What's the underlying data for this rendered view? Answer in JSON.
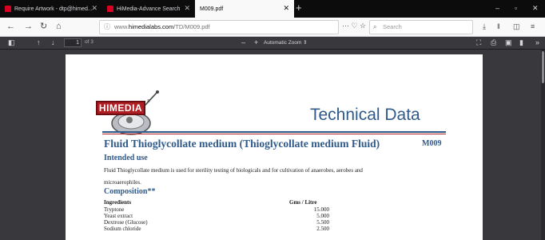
{
  "browser": {
    "tabs": [
      {
        "label": "Require Artwork - dtp@himed..."
      },
      {
        "label": "HiMedia-Advance Search"
      },
      {
        "label": "M009.pdf"
      }
    ],
    "url_prefix": "www.",
    "url_domain": "himedialabs.com",
    "url_path": "/TD/M009.pdf",
    "search_placeholder": "Search"
  },
  "pdf_toolbar": {
    "page_number": "1",
    "page_of": "of 3",
    "zoom": "Automatic Zoom"
  },
  "document": {
    "brand": "HIMEDIA",
    "header": "Technical Data",
    "title": "Fluid Thioglycollate medium (Thioglycollate medium Fluid)",
    "code": "M009",
    "intended_use_heading": "Intended use",
    "intended_use_line1": "Fluid Thioglycollate medium is used for sterility testing of biologicals and for cultivation of anaerobes, aerobes and",
    "intended_use_line2": "microaerophiles.",
    "composition_heading": "Composition**",
    "ingredients_header": "Ingredients",
    "units_header": "Gms / Litre",
    "ingredients": [
      {
        "name": "Tryptone",
        "value": "15.000"
      },
      {
        "name": "Yeast extract",
        "value": "5.000"
      },
      {
        "name": "Dextrose (Glucose)",
        "value": "5.500"
      },
      {
        "name": "Sodium chloride",
        "value": "2.500"
      }
    ]
  }
}
